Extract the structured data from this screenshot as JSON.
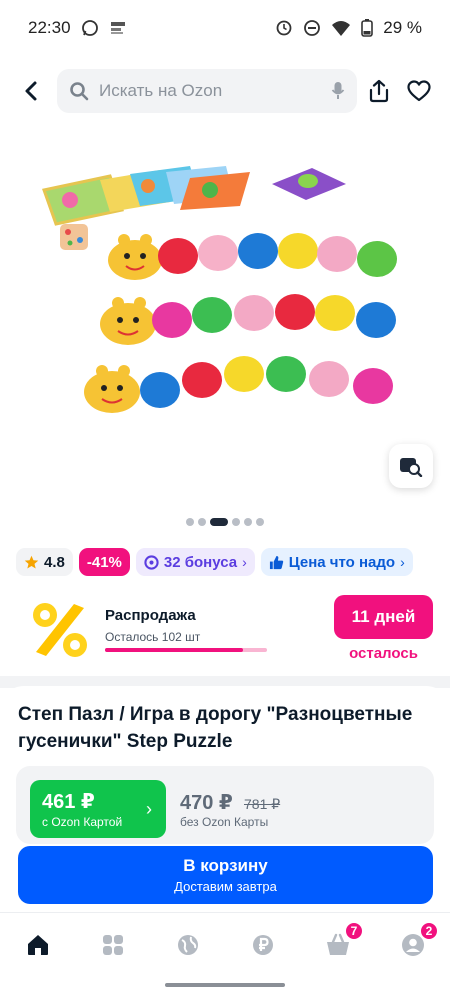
{
  "status_bar": {
    "time": "22:30",
    "battery": "29 %"
  },
  "search": {
    "placeholder": "Искать на Ozon"
  },
  "gallery": {
    "image_count": 6,
    "active_index": 2
  },
  "chips": {
    "rating": "4.8",
    "discount": "-41%",
    "bonus": "32 бонуса",
    "price_tag": "Цена что надо"
  },
  "sale": {
    "title": "Распродажа",
    "remaining": "Осталось 102 шт",
    "progress": 0.85,
    "days": "11 дней",
    "days_label": "осталось"
  },
  "product": {
    "title": "Степ Пазл / Игра в дорогу \"Разноцветные гусенички\" Step Puzzle"
  },
  "price": {
    "ozon_price": "461 ₽",
    "ozon_label": "с Ozon Картой",
    "regular_price": "470 ₽",
    "old_price": "781 ₽",
    "regular_label": "без Ozon Карты"
  },
  "cart": {
    "label": "В корзину",
    "delivery": "Доставим завтра"
  },
  "nav": {
    "cart_badge": "7",
    "profile_badge": "2"
  },
  "colors": {
    "accent": "#005bff",
    "pink": "#f1117e",
    "green": "#10c44c"
  }
}
